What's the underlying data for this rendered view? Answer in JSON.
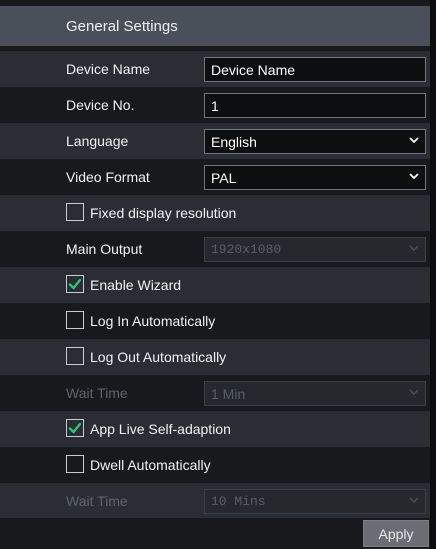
{
  "header": {
    "title": "General Settings"
  },
  "fields": {
    "device_name": {
      "label": "Device Name",
      "value": "Device Name"
    },
    "device_no": {
      "label": "Device No.",
      "value": "1"
    },
    "language": {
      "label": "Language",
      "value": "English"
    },
    "video_format": {
      "label": "Video Format",
      "value": "PAL"
    },
    "fixed_display": {
      "label": "Fixed display resolution",
      "checked": false
    },
    "main_output": {
      "label": "Main Output",
      "value": "1920x1080",
      "enabled": false
    },
    "enable_wizard": {
      "label": "Enable Wizard",
      "checked": true
    },
    "log_in_auto": {
      "label": "Log In Automatically",
      "checked": false
    },
    "log_out_auto": {
      "label": "Log Out Automatically",
      "checked": false
    },
    "wait_time_1": {
      "label": "Wait Time",
      "value": "1 Min",
      "enabled": false
    },
    "app_live": {
      "label": "App Live Self-adaption",
      "checked": true
    },
    "dwell_auto": {
      "label": "Dwell Automatically",
      "checked": false
    },
    "wait_time_2": {
      "label": "Wait Time",
      "value": "10 Mins",
      "enabled": false
    }
  },
  "footer": {
    "apply_label": "Apply"
  },
  "colors": {
    "header_bg": "#4a505a",
    "check_green": "#2fc27a",
    "row_alt": "#2a2d33"
  }
}
